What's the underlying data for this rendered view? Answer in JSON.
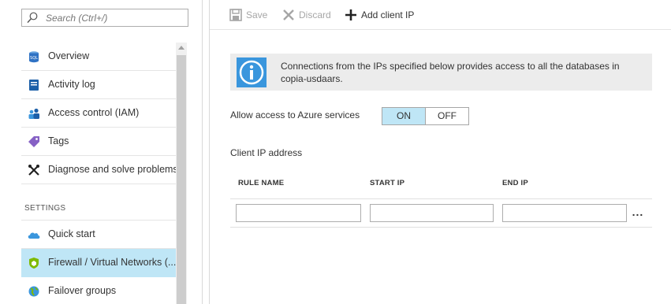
{
  "left_menu": {
    "search_placeholder": "Search (Ctrl+/)",
    "items": [
      {
        "label": "Overview",
        "icon": "sql-database-icon"
      },
      {
        "label": "Activity log",
        "icon": "activity-log-icon"
      },
      {
        "label": "Access control (IAM)",
        "icon": "users-icon"
      },
      {
        "label": "Tags",
        "icon": "tag-icon"
      },
      {
        "label": "Diagnose and solve problems",
        "icon": "wrench-icon"
      }
    ],
    "settings_section": "SETTINGS",
    "settings_items": [
      {
        "label": "Quick start",
        "icon": "cloud-icon"
      },
      {
        "label": "Firewall / Virtual Networks (...",
        "icon": "shield-icon",
        "selected": true
      },
      {
        "label": "Failover groups",
        "icon": "globe-icon"
      }
    ]
  },
  "toolbar": {
    "save_label": "Save",
    "discard_label": "Discard",
    "add_client_ip_label": "Add client IP"
  },
  "info": {
    "text": "Connections from the IPs specified below provides access to all the databases in copia-usdaars."
  },
  "azure_services": {
    "label": "Allow access to Azure services",
    "on_label": "ON",
    "off_label": "OFF",
    "value": "ON"
  },
  "client_ip": {
    "label": "Client IP address",
    "columns": [
      "RULE NAME",
      "START IP",
      "END IP"
    ],
    "row": {
      "rule_name": "",
      "start_ip": "",
      "end_ip": ""
    },
    "more_label": "..."
  },
  "colors": {
    "selected_bg": "#bfe6f6",
    "info_bg": "#ececec",
    "info_icon": "#3a96dd",
    "border": "#adadad"
  }
}
